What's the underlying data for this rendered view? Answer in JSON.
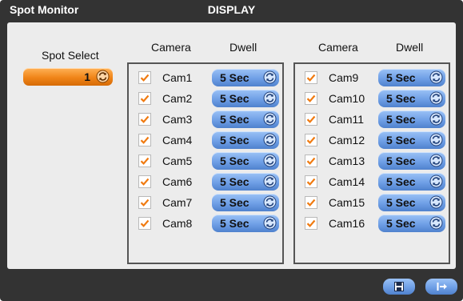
{
  "title": {
    "left": "Spot Monitor",
    "center": "DISPLAY"
  },
  "spot": {
    "label": "Spot Select",
    "value": "1"
  },
  "headers": {
    "camera": "Camera",
    "dwell": "Dwell"
  },
  "groups": [
    {
      "rows": [
        {
          "cam": "Cam1",
          "dwell": "5 Sec",
          "checked": true
        },
        {
          "cam": "Cam2",
          "dwell": "5 Sec",
          "checked": true
        },
        {
          "cam": "Cam3",
          "dwell": "5 Sec",
          "checked": true
        },
        {
          "cam": "Cam4",
          "dwell": "5 Sec",
          "checked": true
        },
        {
          "cam": "Cam5",
          "dwell": "5 Sec",
          "checked": true
        },
        {
          "cam": "Cam6",
          "dwell": "5 Sec",
          "checked": true
        },
        {
          "cam": "Cam7",
          "dwell": "5 Sec",
          "checked": true
        },
        {
          "cam": "Cam8",
          "dwell": "5 Sec",
          "checked": true
        }
      ]
    },
    {
      "rows": [
        {
          "cam": "Cam9",
          "dwell": "5 Sec",
          "checked": true
        },
        {
          "cam": "Cam10",
          "dwell": "5 Sec",
          "checked": true
        },
        {
          "cam": "Cam11",
          "dwell": "5 Sec",
          "checked": true
        },
        {
          "cam": "Cam12",
          "dwell": "5 Sec",
          "checked": true
        },
        {
          "cam": "Cam13",
          "dwell": "5 Sec",
          "checked": true
        },
        {
          "cam": "Cam14",
          "dwell": "5 Sec",
          "checked": true
        },
        {
          "cam": "Cam15",
          "dwell": "5 Sec",
          "checked": true
        },
        {
          "cam": "Cam16",
          "dwell": "5 Sec",
          "checked": true
        }
      ]
    }
  ],
  "footer": {
    "save_icon": "save-icon",
    "exit_icon": "exit-icon"
  },
  "colors": {
    "accent_orange": "#f08418",
    "button_blue": "#6f9fe6",
    "panel_bg": "#ececec",
    "frame_bg": "#333333"
  }
}
